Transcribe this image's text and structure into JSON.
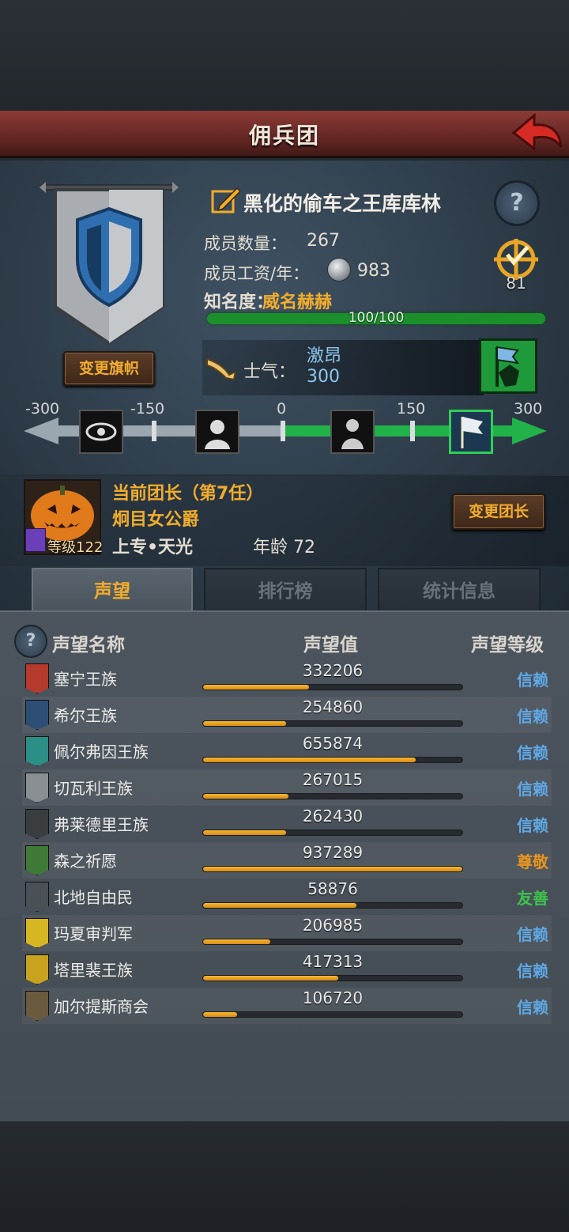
{
  "header": {
    "title": "佣兵团"
  },
  "guild": {
    "name": "黑化的偷车之王库库林",
    "members_label": "成员数量：",
    "members_value": "267",
    "salary_label": "成员工资/年：",
    "salary_value": "983",
    "fame_label": "知名度：",
    "fame_value": "威名赫赫",
    "fame_progress_text": "100/100",
    "fame_progress": 1.0,
    "target_count": "81",
    "change_banner_label": "变更旗帜"
  },
  "morale": {
    "label": "士气：",
    "state": "激昂",
    "value": "300",
    "scale_labels": [
      "-300",
      "-150",
      "0",
      "150",
      "300"
    ]
  },
  "leader": {
    "title": "当前团长（第7任）",
    "name": "炯目女公爵",
    "level": "等级122",
    "info": "上专•天光",
    "age": "年龄  72",
    "change_leader_label": "变更团长"
  },
  "tabs": [
    {
      "label": "声望"
    },
    {
      "label": "排行榜"
    },
    {
      "label": "统计信息"
    }
  ],
  "reputation": {
    "col_name": "声望名称",
    "col_value": "声望值",
    "col_level": "声望等级",
    "rows": [
      {
        "name": "塞宁王族",
        "value": "332206",
        "fill": 0.41,
        "level": "信赖",
        "icon_color": "#b53a2c"
      },
      {
        "name": "希尔王族",
        "value": "254860",
        "fill": 0.32,
        "level": "信赖",
        "icon_color": "#2d4f75"
      },
      {
        "name": "佩尔弗因王族",
        "value": "655874",
        "fill": 0.82,
        "level": "信赖",
        "icon_color": "#2c8f86"
      },
      {
        "name": "切瓦利王族",
        "value": "267015",
        "fill": 0.33,
        "level": "信赖",
        "icon_color": "#8a8f94"
      },
      {
        "name": "弗莱德里王族",
        "value": "262430",
        "fill": 0.32,
        "level": "信赖",
        "icon_color": "#3a3d40"
      },
      {
        "name": "森之祈愿",
        "value": "937289",
        "fill": 1.0,
        "level": "尊敬",
        "icon_color": "#3f7a36"
      },
      {
        "name": "北地自由民",
        "value": "58876",
        "fill": 0.59,
        "level": "友善",
        "icon_color": "#4a5056"
      },
      {
        "name": "玛夏审判军",
        "value": "206985",
        "fill": 0.26,
        "level": "信赖",
        "icon_color": "#d7b623"
      },
      {
        "name": "塔里裴王族",
        "value": "417313",
        "fill": 0.52,
        "level": "信赖",
        "icon_color": "#c9a21e"
      },
      {
        "name": "加尔提斯商会",
        "value": "106720",
        "fill": 0.13,
        "level": "信赖",
        "icon_color": "#6a5a3e"
      }
    ],
    "level_colors": {
      "信赖": "#5fa8e6",
      "尊敬": "#e6951f",
      "友善": "#3fc24d"
    }
  }
}
